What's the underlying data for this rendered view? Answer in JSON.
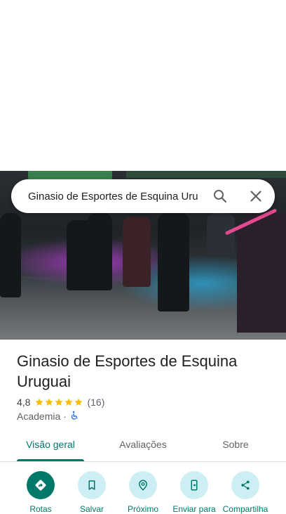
{
  "search": {
    "query": "Ginasio de Esportes de Esquina Uru"
  },
  "place": {
    "name": "Ginasio de Esportes de Esquina Uruguai",
    "rating": "4,8",
    "stars": 5,
    "review_count": "(16)",
    "category": "Academia",
    "separator": "·"
  },
  "tabs": [
    {
      "label": "Visão geral",
      "active": true
    },
    {
      "label": "Avaliações",
      "active": false
    },
    {
      "label": "Sobre",
      "active": false
    }
  ],
  "actions": [
    {
      "label": "Rotas",
      "icon": "directions-icon"
    },
    {
      "label": "Salvar",
      "icon": "bookmark-icon"
    },
    {
      "label": "Próximo",
      "icon": "nearby-icon"
    },
    {
      "label": "Enviar para",
      "icon": "send-to-phone-icon"
    },
    {
      "label": "Compartilha",
      "icon": "share-icon"
    }
  ],
  "colors": {
    "accent": "#00796b",
    "chip": "#cdeff4",
    "star": "#fbbc04",
    "wheelchair": "#1a73e8"
  }
}
